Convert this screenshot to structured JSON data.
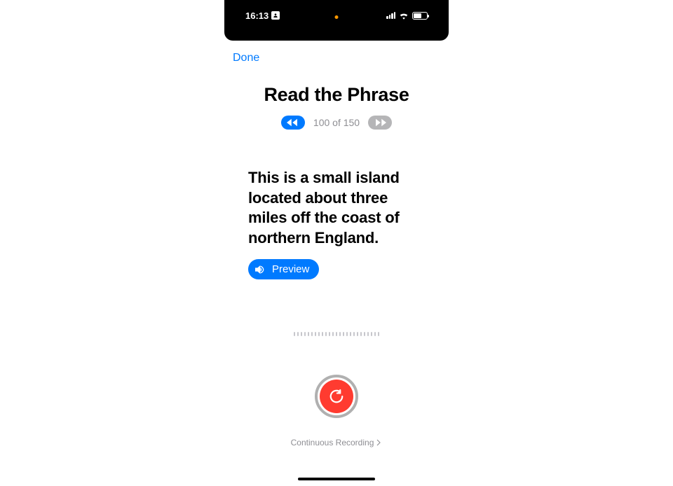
{
  "statusbar": {
    "time": "16:13"
  },
  "nav": {
    "done": "Done"
  },
  "page": {
    "title": "Read the Phrase",
    "counter": "100 of 150"
  },
  "phrase": {
    "text": "This is a small island located about three miles off the coast of northern England.",
    "preview_label": "Preview"
  },
  "footer": {
    "continuous": "Continuous Recording"
  }
}
